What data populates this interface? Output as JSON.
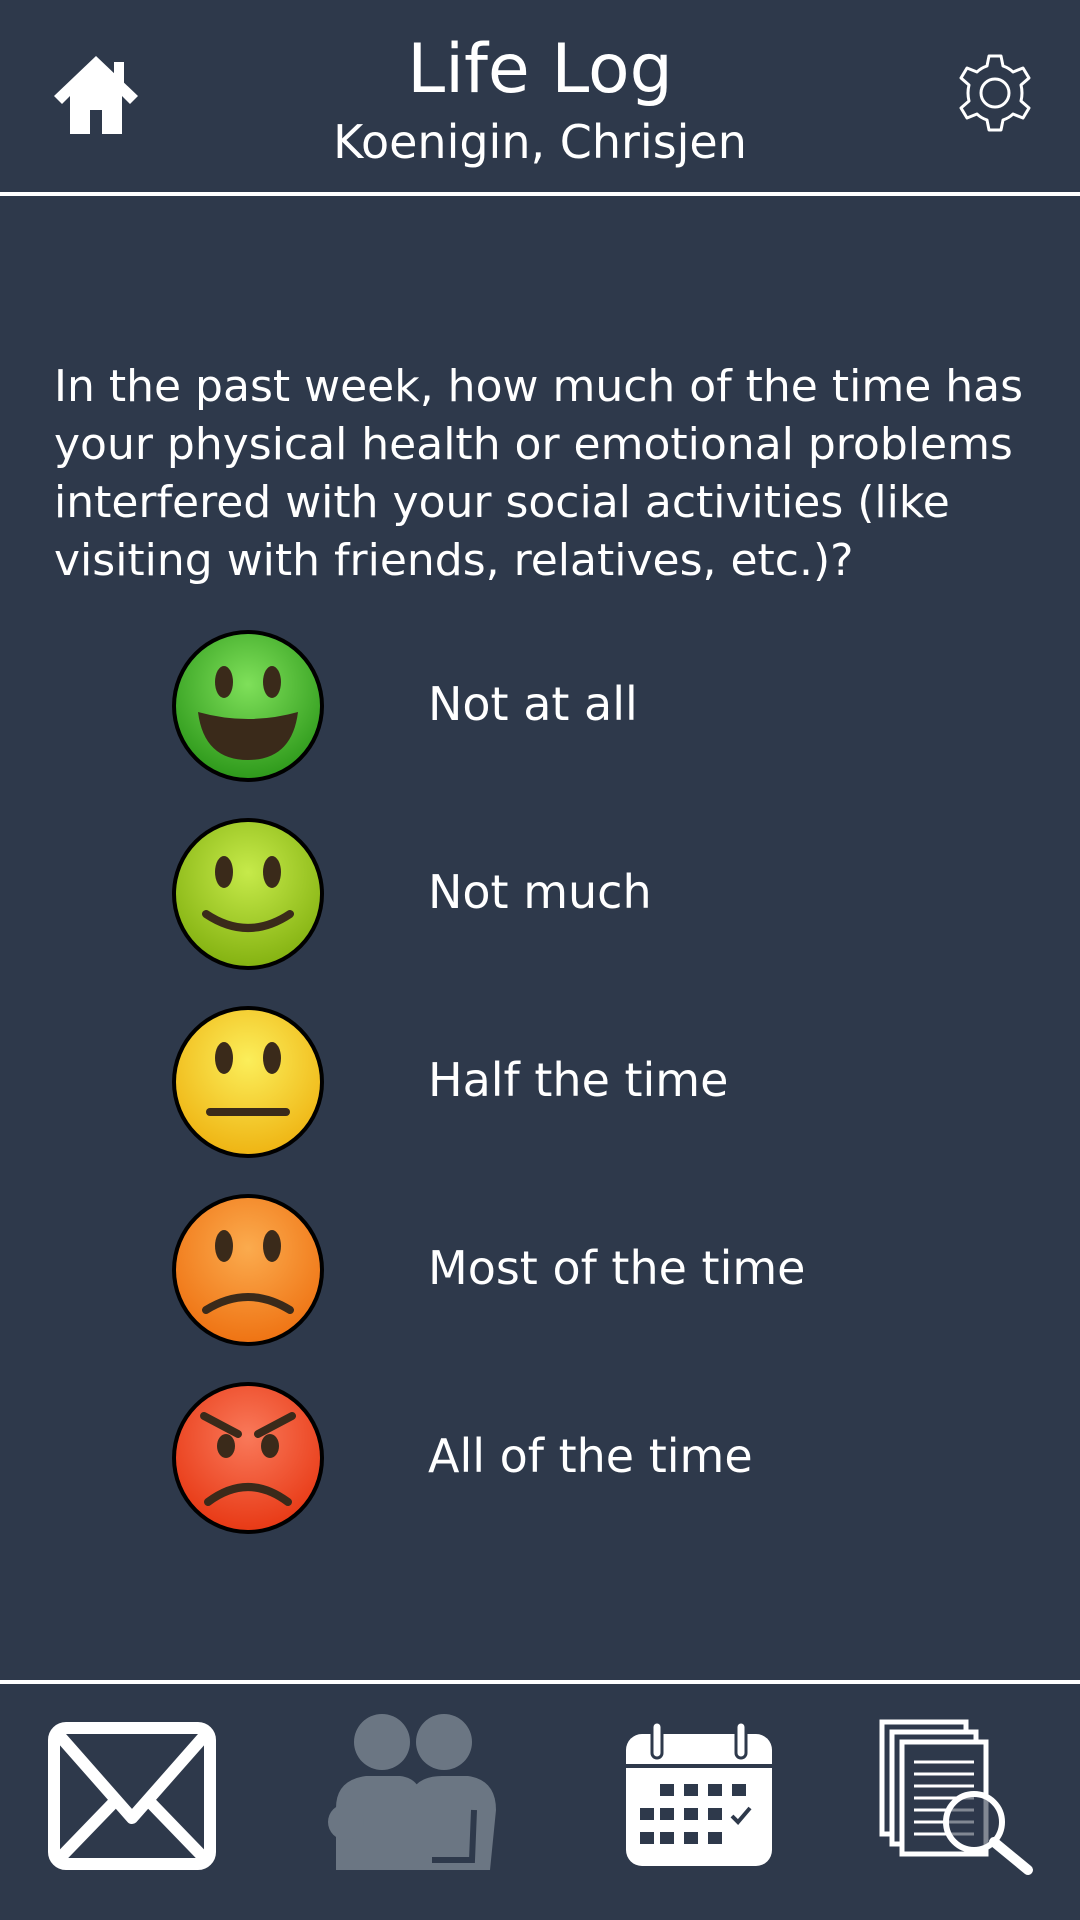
{
  "header": {
    "title": "Life Log",
    "patient_name": "Koenigin, Chrisjen",
    "home_icon": "home-icon",
    "settings_icon": "gear-icon"
  },
  "question": {
    "text": "In the past week, how much of the time has your physical health or emotional problems interfered with your social activities (like visiting with friends, relatives, etc.)?"
  },
  "options": [
    {
      "label": "Not at all",
      "icon": "big-smile-face-icon",
      "color": "#4bb52b"
    },
    {
      "label": "Not much",
      "icon": "smile-face-icon",
      "color": "#9fcb1e"
    },
    {
      "label": "Half the time",
      "icon": "neutral-face-icon",
      "color": "#f2d21a"
    },
    {
      "label": "Most of the time",
      "icon": "frown-face-icon",
      "color": "#f28a1c"
    },
    {
      "label": "All of the time",
      "icon": "angry-face-icon",
      "color": "#ef4423"
    }
  ],
  "bottom_nav": {
    "items": [
      {
        "icon": "mail-icon",
        "enabled": true
      },
      {
        "icon": "people-icon",
        "enabled": false
      },
      {
        "icon": "calendar-icon",
        "enabled": true
      },
      {
        "icon": "documents-search-icon",
        "enabled": true
      }
    ]
  },
  "colors": {
    "background": "#2e394b",
    "foreground": "#ffffff",
    "disabled_icon": "#6b7683"
  }
}
